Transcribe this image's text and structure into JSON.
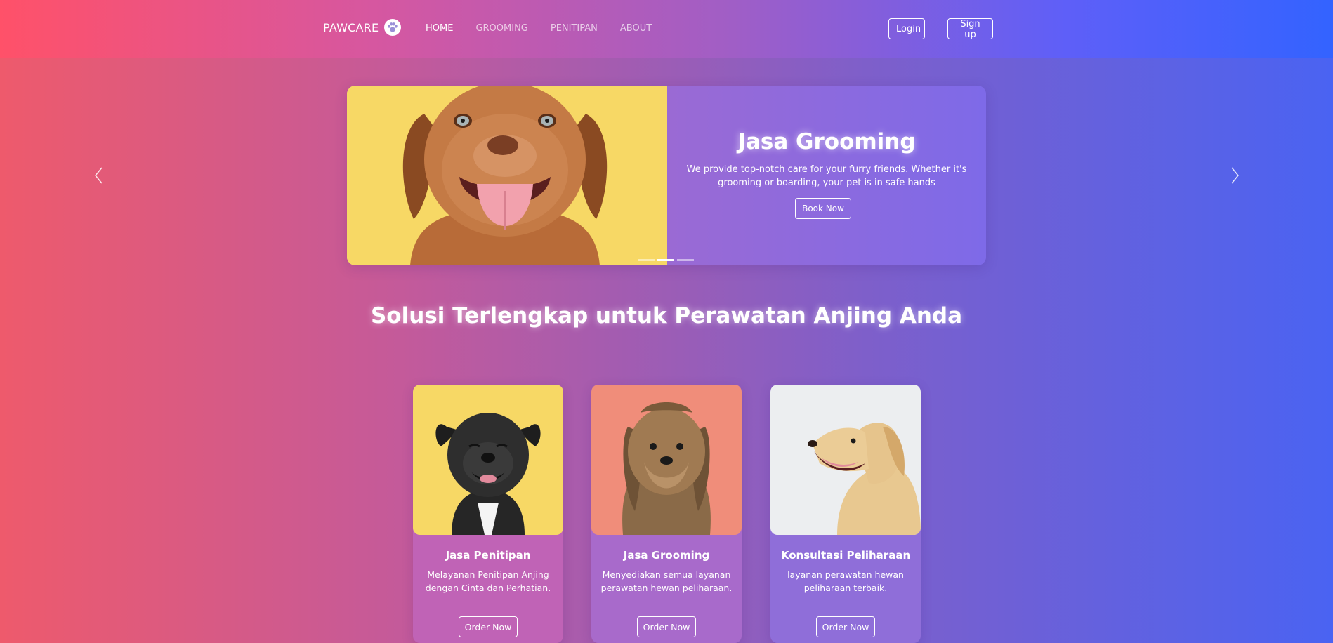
{
  "navbar": {
    "brand": "PAWCARE",
    "brand_icon": "paw-icon",
    "links": [
      {
        "label": "HOME",
        "active": true
      },
      {
        "label": "GROOMING",
        "active": false
      },
      {
        "label": "PENITIPAN",
        "active": false
      },
      {
        "label": "ABOUT",
        "active": false
      }
    ],
    "login_label": "Login",
    "signup_label": "Sign up"
  },
  "carousel": {
    "title": "Jasa Grooming",
    "description": "We provide top-notch care for your furry friends. Whether it's grooming or boarding, your pet is in safe hands",
    "button_label": "Book Now",
    "slide_count": 3,
    "active_slide": 2,
    "image": "puppy-photo"
  },
  "section": {
    "title": "Solusi Terlengkap untuk Perawatan Anjing Anda"
  },
  "cards": [
    {
      "title": "Jasa Penitipan",
      "description": "Melayanan Penitipan Anjing dengan Cinta dan Perhatian.",
      "button_label": "Order Now",
      "image": "black-dog-photo",
      "image_bg": "#f7d865"
    },
    {
      "title": "Jasa Grooming",
      "description": "Menyediakan semua layanan perawatan hewan peliharaan.",
      "button_label": "Order Now",
      "image": "yorkie-dog-photo",
      "image_bg": "#f08d7a"
    },
    {
      "title": "Konsultasi Peliharaan",
      "description": "layanan perawatan hewan peliharaan terbaik.",
      "button_label": "Order Now",
      "image": "golden-retriever-photo",
      "image_bg": "#eceef0"
    }
  ],
  "colors": {
    "gradient_start": "#ee5a6c",
    "gradient_end": "#4a63f2",
    "hero_image_bg": "#f7d865"
  }
}
